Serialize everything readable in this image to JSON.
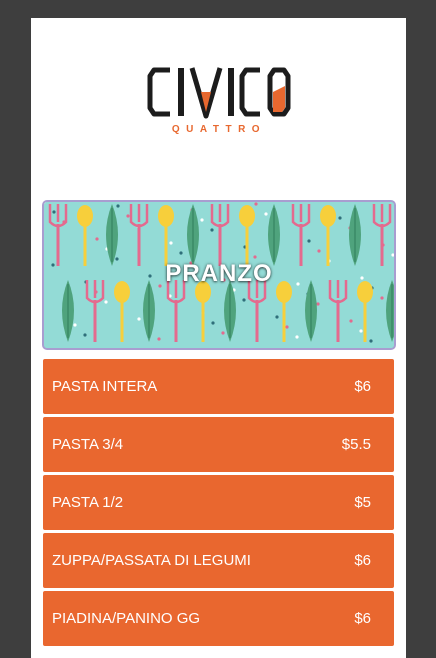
{
  "logo": {
    "name": "CIVICO",
    "tagline": "QUATTRO",
    "colors": {
      "dark": "#1c1c1c",
      "accent": "#e8682f"
    }
  },
  "banner": {
    "title": "PRANZO",
    "pattern_icons": [
      "fork-icon",
      "knife-icon",
      "spoon-icon",
      "lemon-icon",
      "leaf-icon"
    ],
    "colors": {
      "background": "#93dbd6",
      "fork": "#e46a8e",
      "spoon": "#f7cf3b",
      "leaf": "#4fa37d"
    }
  },
  "menu": {
    "items": [
      {
        "name": "PASTA INTERA",
        "price": "$6"
      },
      {
        "name": "PASTA 3/4",
        "price": "$5.5"
      },
      {
        "name": "PASTA 1/2",
        "price": "$5"
      },
      {
        "name": "ZUPPA/PASSATA DI LEGUMI",
        "price": "$6"
      },
      {
        "name": "PIADINA/PANINO GG",
        "price": "$6"
      }
    ],
    "colors": {
      "item_background": "#e9672f",
      "text": "#ffffff"
    }
  }
}
